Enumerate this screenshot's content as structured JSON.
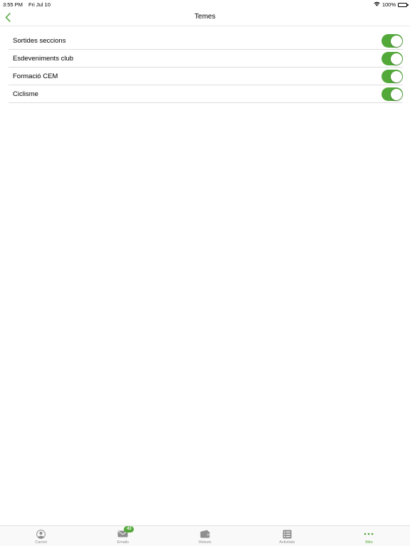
{
  "status_bar": {
    "time": "3:55 PM",
    "date": "Fri Jul 10",
    "battery": "100%"
  },
  "nav": {
    "title": "Temes",
    "back_icon": "chevron-left-icon"
  },
  "topics": [
    {
      "label": "Sortides seccions",
      "enabled": true
    },
    {
      "label": "Esdeveniments club",
      "enabled": true
    },
    {
      "label": "Formació CEM",
      "enabled": true
    },
    {
      "label": "Ciclisme",
      "enabled": true
    }
  ],
  "tabs": [
    {
      "label": "Carnet",
      "icon": "person-icon",
      "active": false
    },
    {
      "label": "Emails",
      "icon": "envelope-icon",
      "badge": "43",
      "active": false
    },
    {
      "label": "Rebuts",
      "icon": "wallet-icon",
      "active": false
    },
    {
      "label": "Activitats",
      "icon": "list-icon",
      "active": false
    },
    {
      "label": "Més",
      "icon": "more-dots-icon",
      "active": true
    }
  ],
  "colors": {
    "accent": "#53a83a",
    "toggle_on": "#53a83a"
  }
}
